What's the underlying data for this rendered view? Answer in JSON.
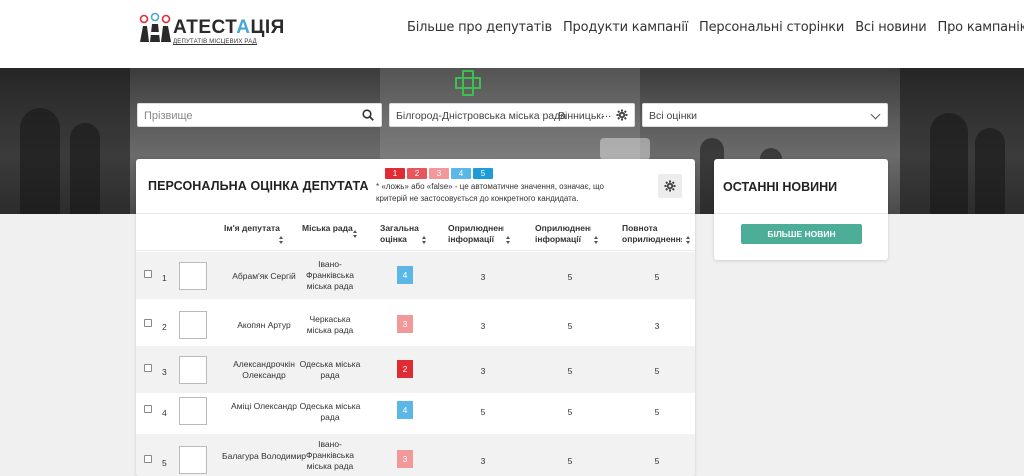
{
  "logo": {
    "title_a": "АТЕСТ",
    "title_b": "А",
    "title_c": "ЦІЯ",
    "subtitle": "ДЕПУТАТІВ МІСЦЕВИХ РАД"
  },
  "nav": [
    "Більше про депутатів",
    "Продукти кампанії",
    "Персональні сторінки",
    "Всі новини",
    "Про кампанію"
  ],
  "filters": {
    "surname_placeholder": "Прізвище",
    "council_selected": [
      "Білгород-Дністровська міська рада",
      "Вінницька міська рада"
    ],
    "council_more": "...",
    "rating_selected": "Всі оцінки"
  },
  "card": {
    "title": "ПЕРСОНАЛЬНА ОЦІНКА ДЕПУТАТА",
    "legend": [
      {
        "label": "1",
        "color": "#e02b35"
      },
      {
        "label": "2",
        "color": "#e8555a"
      },
      {
        "label": "3",
        "color": "#f29898"
      },
      {
        "label": "4",
        "color": "#5bb8e6"
      },
      {
        "label": "5",
        "color": "#1f9bd8"
      }
    ],
    "note": "* «ложь» або «false» - це автоматичне значення, означає, що критерій не застосовується до конкретного кандидата.",
    "columns": [
      "Ім'я депутата",
      "Міська рада",
      "Загальна оцінка",
      "Оприлюднення інформації про",
      "Оприлюднення інформації про",
      "Повнота оприлюднення"
    ],
    "rows": [
      {
        "n": "1",
        "name": "Абрам'як Сергій",
        "city": "Івано-Франківська міська рада",
        "score": "4",
        "score_color": "#5bb8e6",
        "c1": "3",
        "c2": "5",
        "c3": "5"
      },
      {
        "n": "2",
        "name": "Акопян Артур",
        "city": "Черкаська міська рада",
        "score": "3",
        "score_color": "#f29898",
        "c1": "3",
        "c2": "5",
        "c3": "3"
      },
      {
        "n": "3",
        "name": "Александрочкін Олександр",
        "city": "Одеська міська рада",
        "score": "2",
        "score_color": "#e02b35",
        "c1": "3",
        "c2": "5",
        "c3": "5"
      },
      {
        "n": "4",
        "name": "Аміці Олександр",
        "city": "Одеська міська рада",
        "score": "4",
        "score_color": "#5bb8e6",
        "c1": "5",
        "c2": "5",
        "c3": "5"
      },
      {
        "n": "5",
        "name": "Балагура Володимир",
        "city": "Івано-Франківська міська рада",
        "score": "3",
        "score_color": "#f29898",
        "c1": "3",
        "c2": "5",
        "c3": "5"
      }
    ]
  },
  "news": {
    "title": "ОСТАННІ НОВИНИ",
    "button": "БІЛЬШЕ НОВИН"
  }
}
